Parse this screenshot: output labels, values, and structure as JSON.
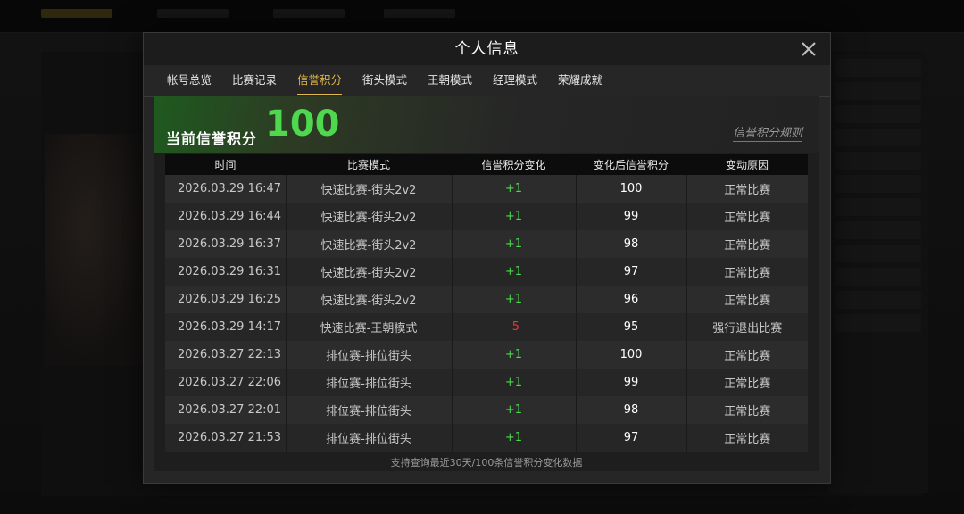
{
  "modal": {
    "title": "个人信息",
    "tabs": [
      {
        "label": "帐号总览"
      },
      {
        "label": "比赛记录"
      },
      {
        "label": "信誉积分"
      },
      {
        "label": "街头模式"
      },
      {
        "label": "王朝模式"
      },
      {
        "label": "经理模式"
      },
      {
        "label": "荣耀成就"
      }
    ],
    "active_tab": 2
  },
  "credit": {
    "label": "当前信誉积分",
    "score": "100",
    "rules_link": "信誉积分规则"
  },
  "table": {
    "headers": [
      "时间",
      "比赛模式",
      "信誉积分变化",
      "变化后信誉积分",
      "变动原因"
    ],
    "rows": [
      {
        "time": "2026.03.29  16:47",
        "mode": "快速比赛-街头2v2",
        "delta": "+1",
        "after": "100",
        "reason": "正常比赛",
        "sign": "pos"
      },
      {
        "time": "2026.03.29  16:44",
        "mode": "快速比赛-街头2v2",
        "delta": "+1",
        "after": "99",
        "reason": "正常比赛",
        "sign": "pos"
      },
      {
        "time": "2026.03.29  16:37",
        "mode": "快速比赛-街头2v2",
        "delta": "+1",
        "after": "98",
        "reason": "正常比赛",
        "sign": "pos"
      },
      {
        "time": "2026.03.29  16:31",
        "mode": "快速比赛-街头2v2",
        "delta": "+1",
        "after": "97",
        "reason": "正常比赛",
        "sign": "pos"
      },
      {
        "time": "2026.03.29  16:25",
        "mode": "快速比赛-街头2v2",
        "delta": "+1",
        "after": "96",
        "reason": "正常比赛",
        "sign": "pos"
      },
      {
        "time": "2026.03.29  14:17",
        "mode": "快速比赛-王朝模式",
        "delta": "-5",
        "after": "95",
        "reason": "强行退出比赛",
        "sign": "neg"
      },
      {
        "time": "2026.03.27  22:13",
        "mode": "排位赛-排位街头",
        "delta": "+1",
        "after": "100",
        "reason": "正常比赛",
        "sign": "pos"
      },
      {
        "time": "2026.03.27  22:06",
        "mode": "排位赛-排位街头",
        "delta": "+1",
        "after": "99",
        "reason": "正常比赛",
        "sign": "pos"
      },
      {
        "time": "2026.03.27  22:01",
        "mode": "排位赛-排位街头",
        "delta": "+1",
        "after": "98",
        "reason": "正常比赛",
        "sign": "pos"
      },
      {
        "time": "2026.03.27  21:53",
        "mode": "排位赛-排位街头",
        "delta": "+1",
        "after": "97",
        "reason": "正常比赛",
        "sign": "pos"
      }
    ]
  },
  "footer_note": "支持查询最近30天/100条信誉积分变化数据",
  "colors": {
    "accent": "#e0b84d",
    "positive": "#4ed84e",
    "negative": "#ee3333"
  }
}
